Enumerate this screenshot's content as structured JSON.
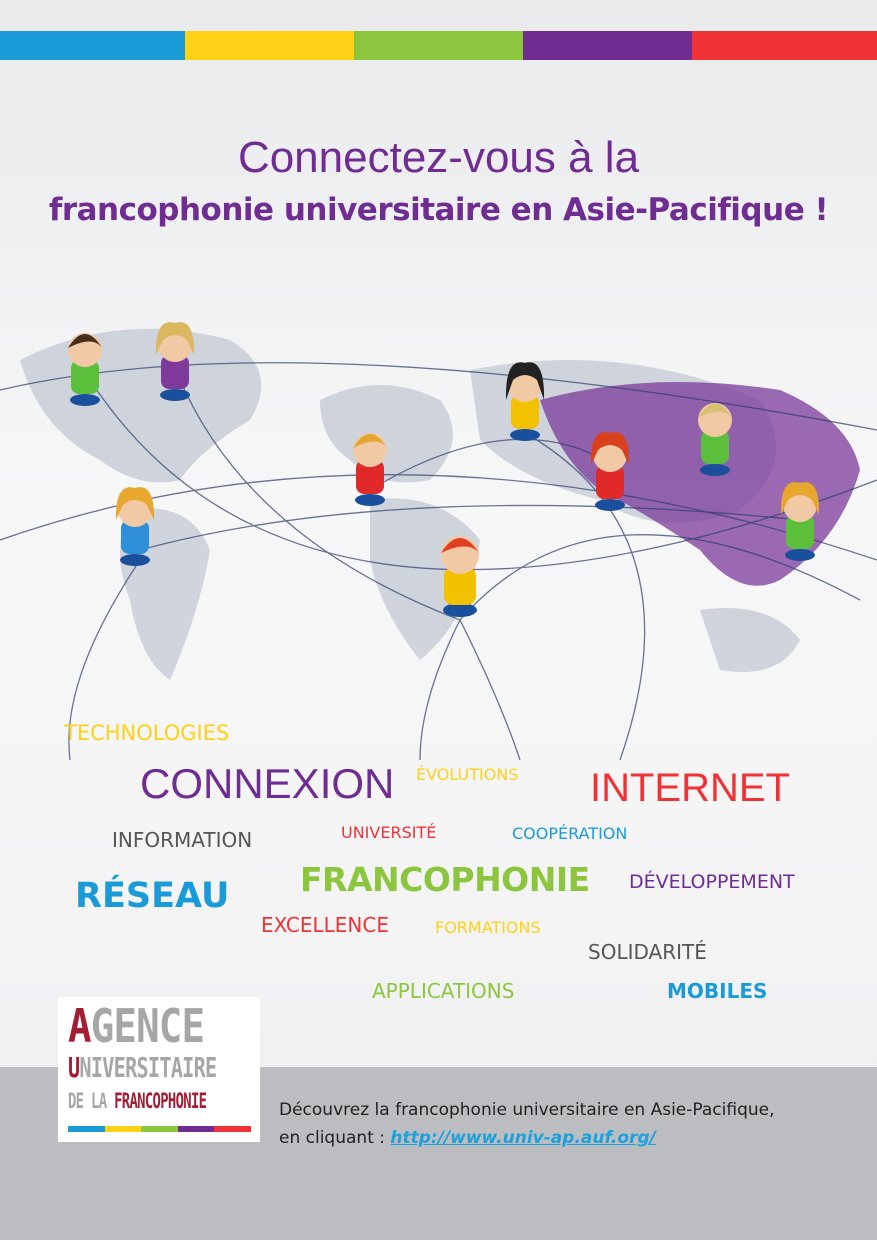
{
  "colors": {
    "blue": "#1a9bd7",
    "yellow": "#fcd116",
    "green": "#8cc63f",
    "purple": "#6f2c91",
    "red": "#ee3235",
    "gray": "#555555"
  },
  "header": {
    "title_line1": "Connectez-vous à la",
    "title_line2": "francophonie universitaire en Asie-Pacifique !"
  },
  "words": [
    {
      "text": "TECHNOLOGIES",
      "color": "#fcd116"
    },
    {
      "text": "CONNEXION",
      "color": "#6f2c91"
    },
    {
      "text": "ÉVOLUTIONS",
      "color": "#fcd116"
    },
    {
      "text": "INTERNET",
      "color": "#ee3235"
    },
    {
      "text": "INFORMATION",
      "color": "#555555"
    },
    {
      "text": "UNIVERSITÉ",
      "color": "#ee3235"
    },
    {
      "text": "COOPÉRATION",
      "color": "#1a9bd7"
    },
    {
      "text": "RÉSEAU",
      "color": "#1a9bd7"
    },
    {
      "text": "FRANCOPHONIE",
      "color": "#8cc63f"
    },
    {
      "text": "DÉVELOPPEMENT",
      "color": "#6f2c91"
    },
    {
      "text": "EXCELLENCE",
      "color": "#ee3235"
    },
    {
      "text": "FORMATIONS",
      "color": "#fcd116"
    },
    {
      "text": "SOLIDARITÉ",
      "color": "#555555"
    },
    {
      "text": "APPLICATIONS",
      "color": "#8cc63f"
    },
    {
      "text": "MOBILES",
      "color": "#1a9bd7"
    }
  ],
  "logo": {
    "line1_initial": "A",
    "line1_rest": "GENCE",
    "line2_initial": "U",
    "line2_rest": "NIVERSITAIRE",
    "line3_gray": "DE LA ",
    "line3_red": "FRANCOPHONIE"
  },
  "footer": {
    "text_line1": "Découvrez la francophonie universitaire en Asie-Pacifique,",
    "text_line2_prefix": "en cliquant : ",
    "link": "http://www.univ-ap.auf.org/"
  }
}
